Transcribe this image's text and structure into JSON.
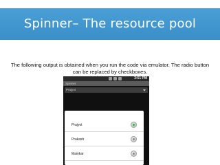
{
  "slide": {
    "title": "Spinner– The resource pool",
    "body_line1": "The following output is obtained when you run the code via emulator. The radio button",
    "body_line2": "can be replaced by checkboxes."
  },
  "phone": {
    "time": "3:51",
    "time_suffix": "PM",
    "app_title": "Spinner",
    "spinner_value": "Prajyot",
    "options": [
      {
        "label": "Prajyot",
        "checked": true
      },
      {
        "label": "Prakash",
        "checked": false
      },
      {
        "label": "Mainkar",
        "checked": false
      }
    ]
  },
  "colors": {
    "title_bar": "#4a9fd6",
    "radio_checked": "#39b54a"
  }
}
